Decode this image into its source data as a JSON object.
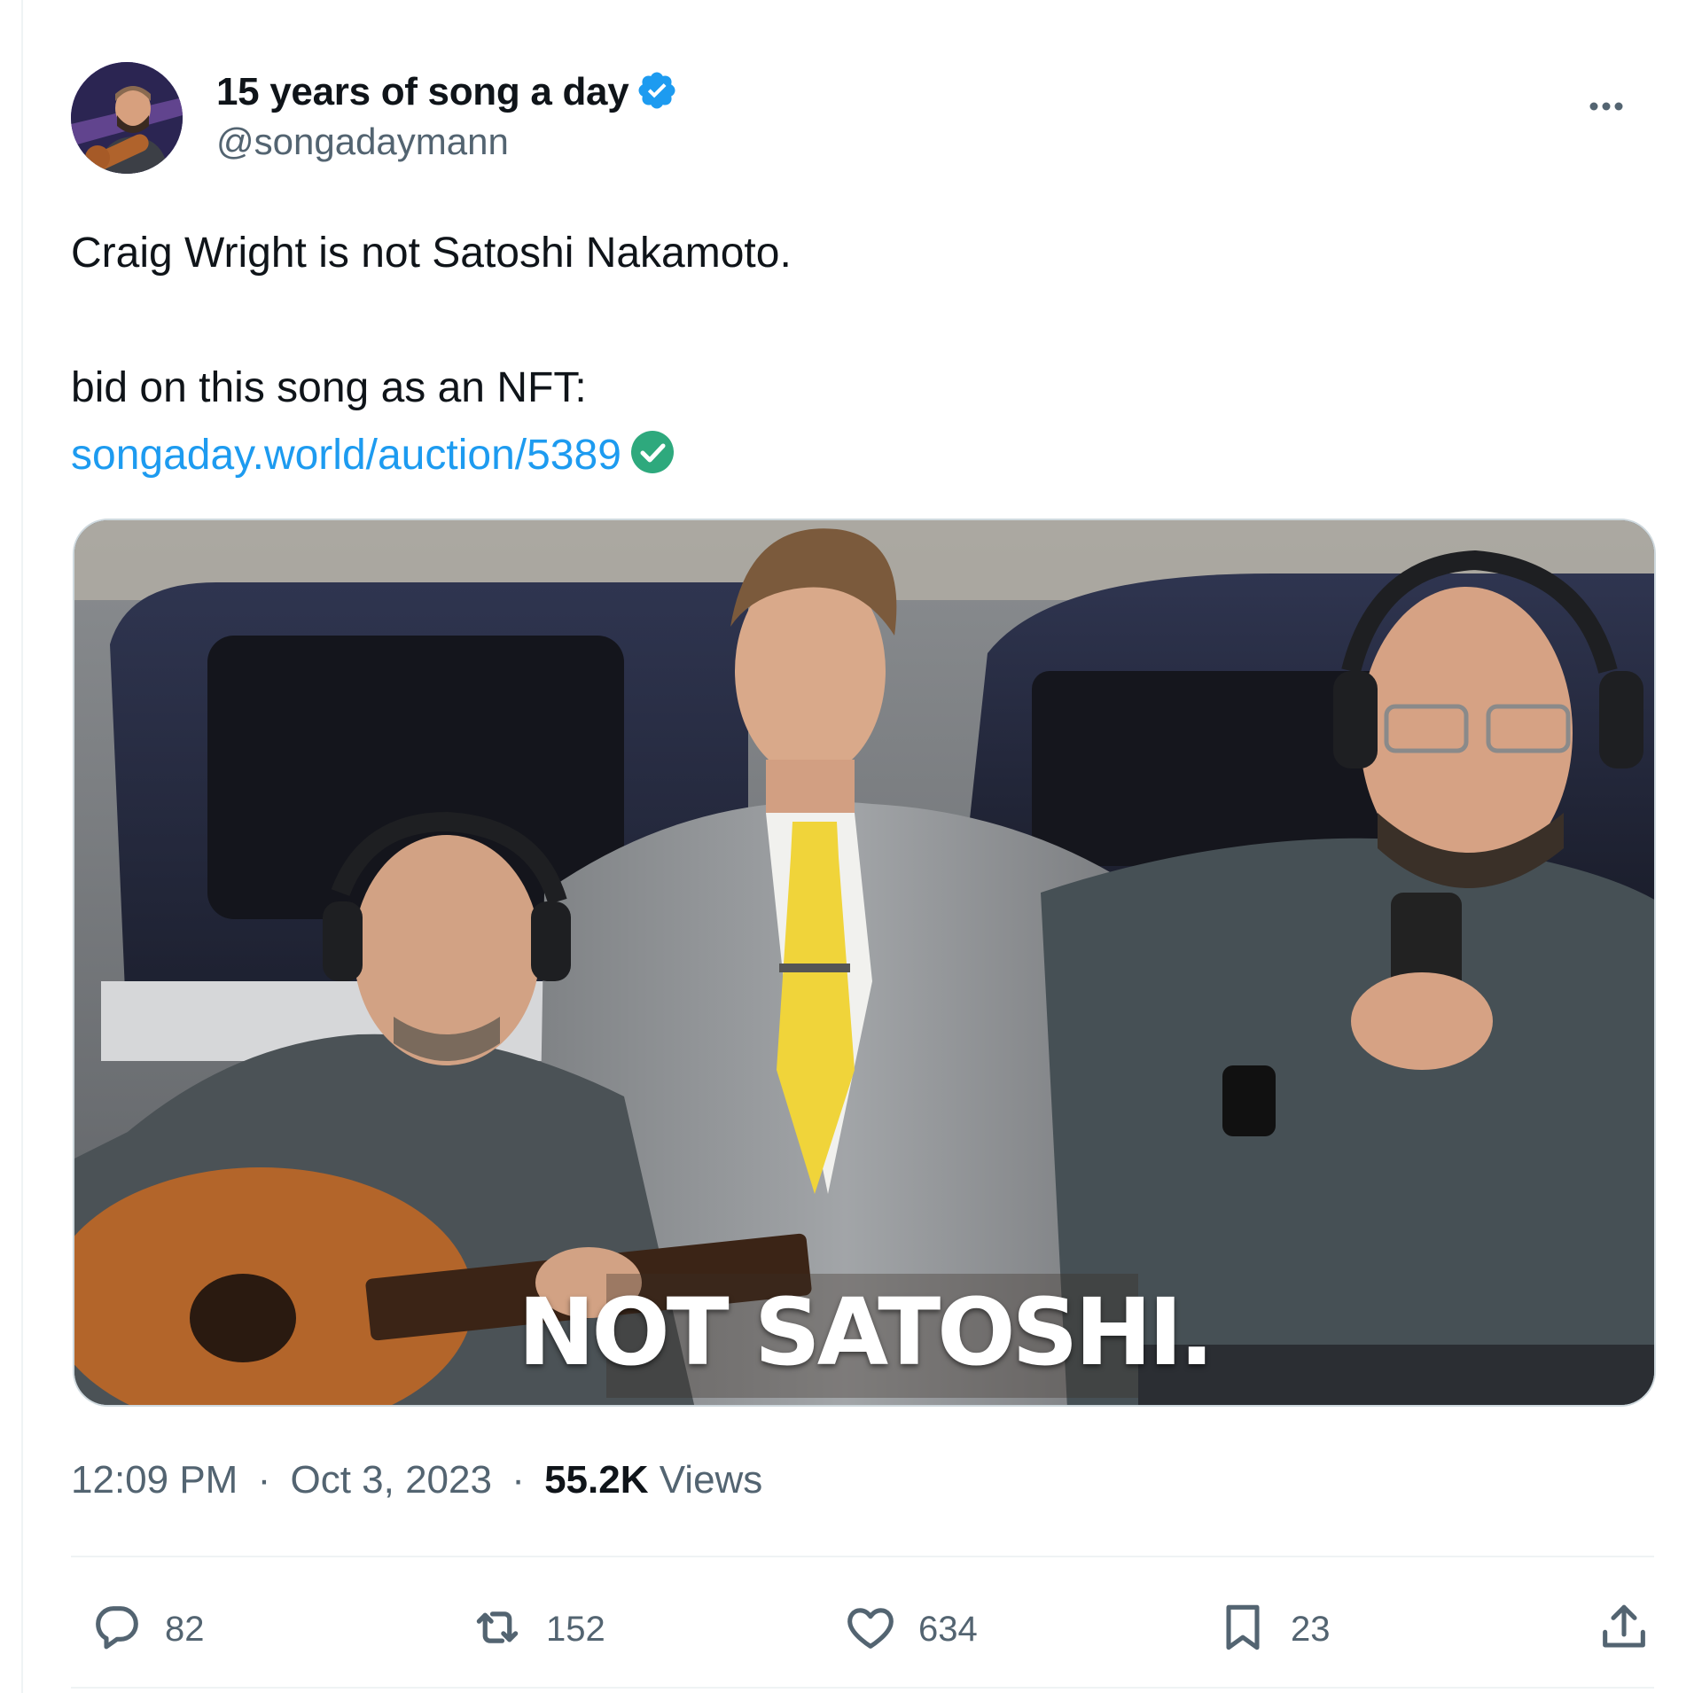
{
  "author": {
    "name": "15 years of song a day",
    "handle": "@songadaymann",
    "verified": true
  },
  "tweet": {
    "line1": "Craig Wright is not Satoshi Nakamoto.",
    "line2": "bid on this song as an NFT:",
    "link": "songaday.world/auction/5389"
  },
  "media": {
    "caption": "NOT SATOSHI."
  },
  "meta": {
    "time": "12:09 PM",
    "separator": "·",
    "date": "Oct 3, 2023",
    "views_count": "55.2K",
    "views_label": "Views"
  },
  "actions": {
    "replies": "82",
    "reposts": "152",
    "likes": "634",
    "bookmarks": "23"
  },
  "colors": {
    "link": "#1d9bf0",
    "verified": "#1d9bf0",
    "link_check": "#2ea97d",
    "secondary_text": "#536471"
  },
  "icons": [
    "more-icon",
    "verified-badge-icon",
    "check-icon",
    "reply-icon",
    "repost-icon",
    "like-icon",
    "bookmark-icon",
    "share-icon"
  ]
}
